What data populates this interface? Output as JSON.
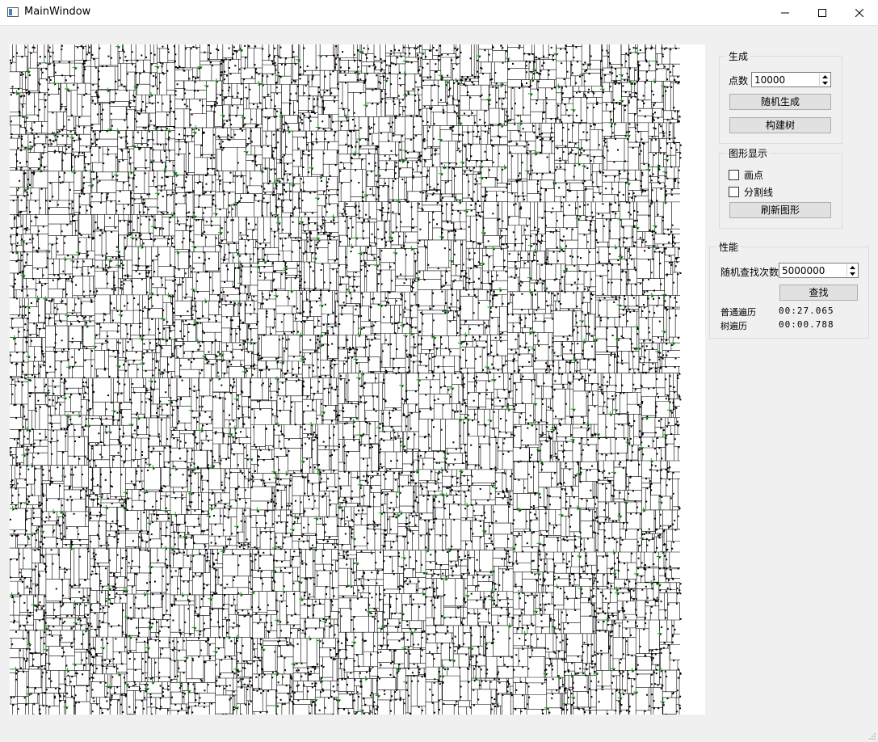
{
  "window": {
    "title": "MainWindow"
  },
  "panel": {
    "generate": {
      "title": "生成",
      "count_label": "点数",
      "count_value": "10000",
      "random_button": "随机生成",
      "build_button": "构建树"
    },
    "display": {
      "title": "图形显示",
      "draw_points_label": "画点",
      "draw_points_checked": false,
      "split_lines_label": "分割线",
      "split_lines_checked": false,
      "refresh_button": "刷新图形"
    },
    "performance": {
      "title": "性能",
      "search_count_label": "随机查找次数",
      "search_count_value": "5000000",
      "search_button": "查找",
      "linear_label": "普通遍历",
      "linear_time": "00:27.065",
      "tree_label": "树遍历",
      "tree_time": "00:00.788"
    }
  },
  "colors": {
    "points": "#000000",
    "split_lines": "#000000",
    "node_marks": "#2e8b2e",
    "canvas_bg": "#ffffff"
  }
}
